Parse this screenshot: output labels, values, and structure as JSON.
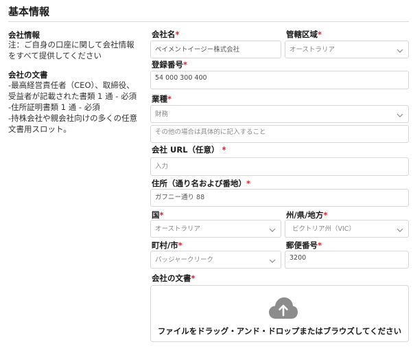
{
  "section": {
    "title": "基本情報"
  },
  "sidebar": {
    "company_info_title": "会社情報",
    "company_info_desc_1": "注：ご自身の口座に関して会社情報",
    "company_info_desc_2": "をすべて提供してください",
    "documents_title": "会社の文書",
    "documents_lines": [
      "-最高経営責任者（CEO）、取締役、",
      "受益者が記載された書類 1 通 - 必須",
      "-住所証明書類 1 通 - 必須",
      "-持株会社や親会社向けの多くの任意",
      "文書用スロット。"
    ]
  },
  "form": {
    "company_name": {
      "label": "会社名",
      "value": "ペイメントイージー株式会社"
    },
    "jurisdiction": {
      "label": "管轄区域",
      "value": "オーストラリア"
    },
    "registration": {
      "label": "登録番号",
      "value": "54 000 300 400"
    },
    "industry": {
      "label": "業種",
      "value": "財務",
      "other_placeholder": "その他の場合は具体的に記入すること"
    },
    "url": {
      "label": "会社 URL（任意）",
      "placeholder": "入力"
    },
    "address": {
      "label": "住所（通り名および番地）",
      "value": "ガフニー通り 88"
    },
    "country": {
      "label": "国",
      "value": "オーストラリア"
    },
    "state": {
      "label": "州/県/地方",
      "value": "ビクトリア州（VIC）"
    },
    "city": {
      "label": "町村/市",
      "value": "パッジャークリーク"
    },
    "postcode": {
      "label": "郵便番号",
      "value": "3200"
    },
    "documents": {
      "label": "会社の文書",
      "upload_text": "ファイルをドラッグ・アンド・ドロップまたはブラウズしてください"
    },
    "required_mark": "*"
  },
  "colors": {
    "required": "#d9232d",
    "upload_icon": "#8c8c8c",
    "border": "#d6d6d6"
  },
  "icons": {
    "dropdown": "chevron-down-icon",
    "upload": "cloud-upload-icon"
  }
}
